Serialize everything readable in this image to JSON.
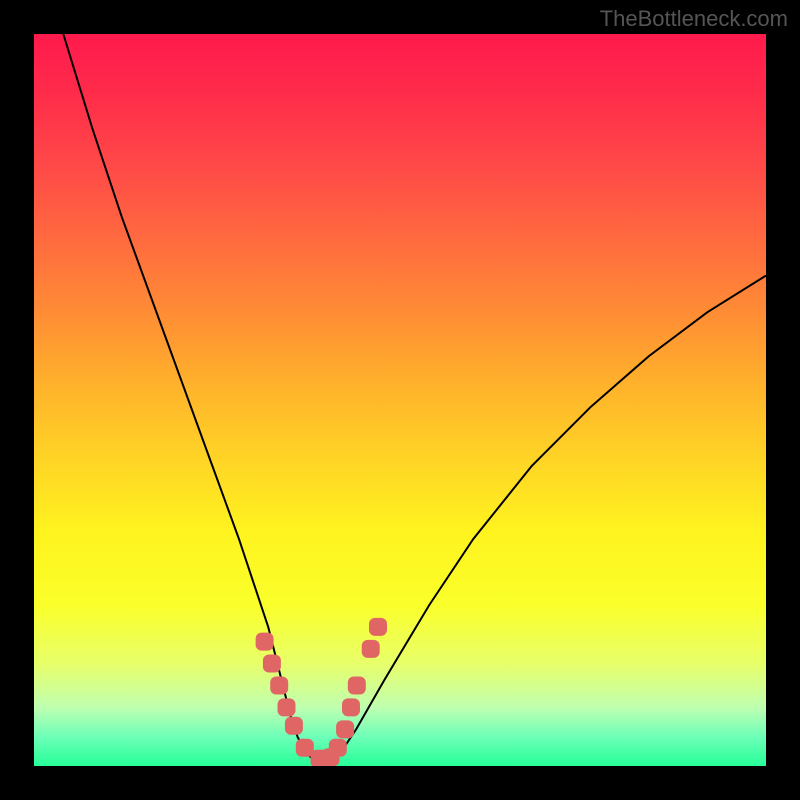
{
  "watermark": "TheBottleneck.com",
  "chart_data": {
    "type": "line",
    "title": "",
    "xlabel": "",
    "ylabel": "",
    "xlim": [
      0,
      100
    ],
    "ylim": [
      0,
      100
    ],
    "grid": false,
    "legend": false,
    "series": [
      {
        "name": "bottleneck-curve",
        "color": "#000000",
        "x": [
          4,
          8,
          12,
          16,
          20,
          24,
          28,
          30,
          32,
          33,
          34,
          35,
          36,
          37,
          38,
          39,
          40,
          41,
          42,
          44,
          48,
          54,
          60,
          68,
          76,
          84,
          92,
          100
        ],
        "y": [
          100,
          87,
          75,
          64,
          53,
          42,
          31,
          25,
          19,
          15,
          11,
          7,
          4,
          2,
          1,
          0.5,
          0.5,
          1,
          2,
          5,
          12,
          22,
          31,
          41,
          49,
          56,
          62,
          67
        ]
      },
      {
        "name": "marker-dots",
        "color": "#e06666",
        "type_hint": "scatter",
        "x": [
          31.5,
          32.5,
          33.5,
          34.5,
          35.5,
          37,
          39,
          40.5,
          41.5,
          42.5,
          43.3,
          44.1,
          46,
          47
        ],
        "y": [
          17,
          14,
          11,
          8,
          5.5,
          2.5,
          1,
          1.2,
          2.5,
          5,
          8,
          11,
          16,
          19
        ]
      }
    ],
    "background_gradient": {
      "top": "#ff1a4d",
      "mid": "#fff31f",
      "bottom": "#26ff98"
    }
  }
}
